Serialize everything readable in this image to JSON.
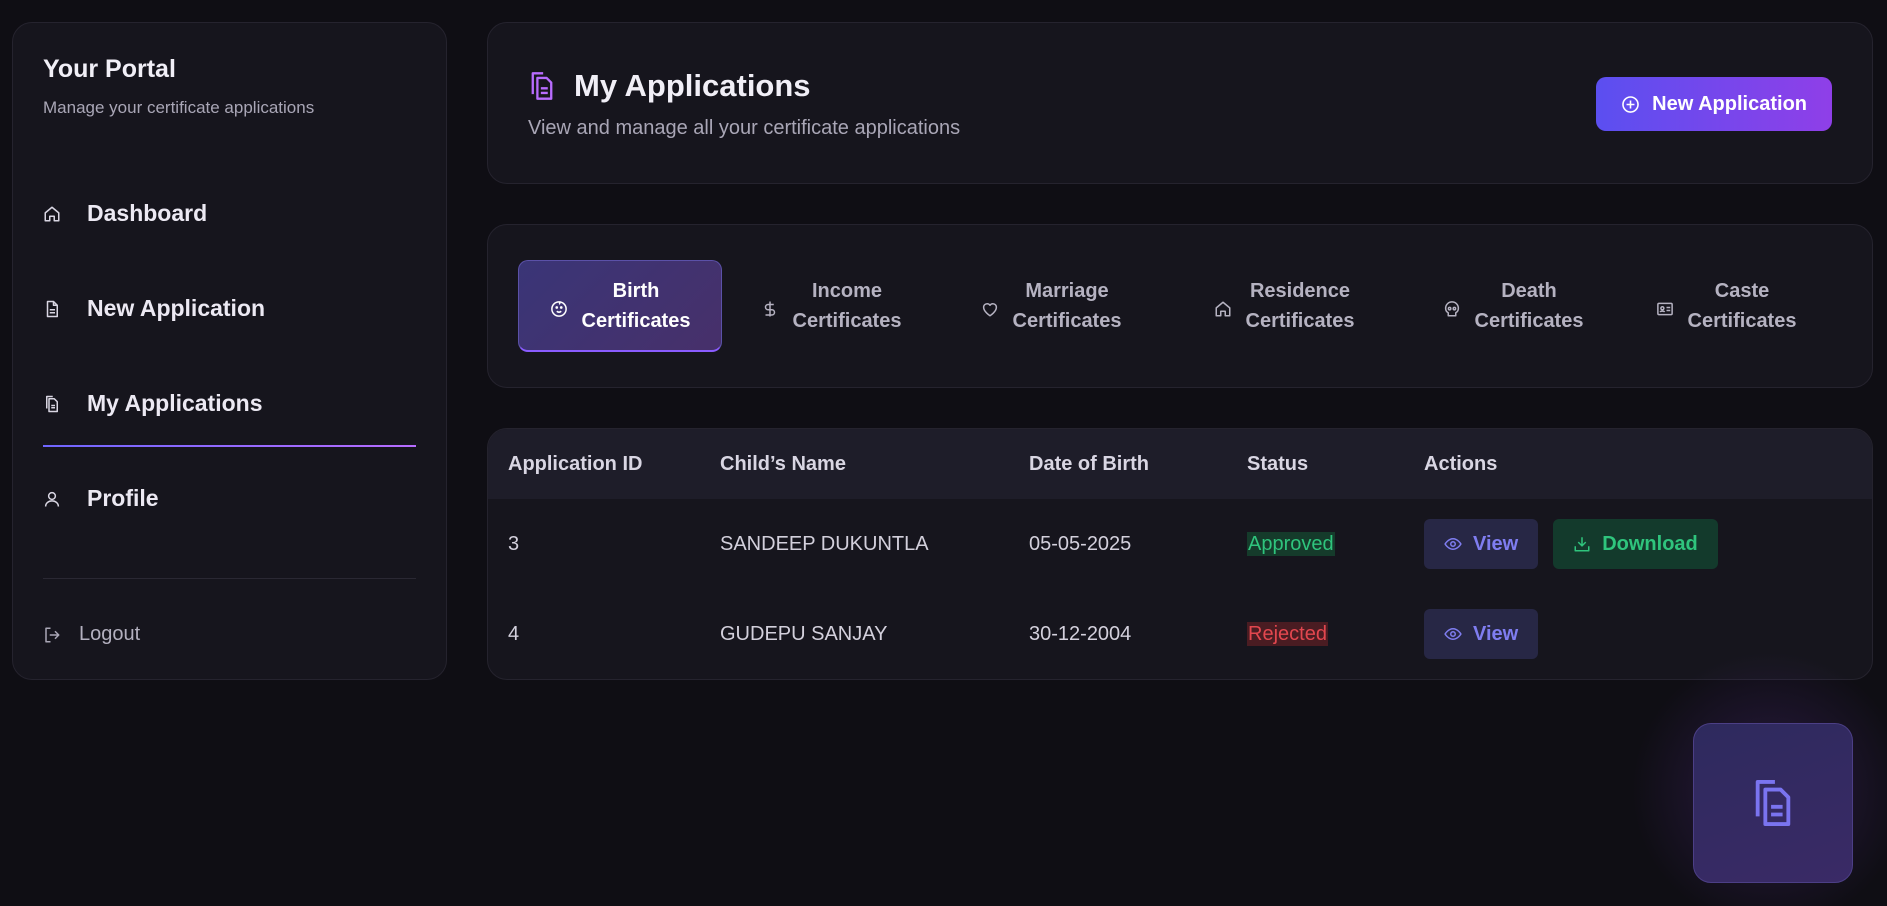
{
  "sidebar": {
    "title": "Your Portal",
    "subtitle": "Manage your certificate applications",
    "items": [
      {
        "label": "Dashboard",
        "icon": "home-icon"
      },
      {
        "label": "New Application",
        "icon": "file-icon"
      },
      {
        "label": "My Applications",
        "icon": "files-icon",
        "active": true
      },
      {
        "label": "Profile",
        "icon": "user-icon"
      }
    ],
    "logout_label": "Logout"
  },
  "header": {
    "title": "My Applications",
    "subtitle": "View and manage all your certificate applications",
    "new_button_label": "New Application"
  },
  "tabs": [
    {
      "line1": "Birth",
      "line2": "Certificates",
      "icon": "baby-icon",
      "active": true
    },
    {
      "line1": "Income",
      "line2": "Certificates",
      "icon": "dollar-icon"
    },
    {
      "line1": "Marriage",
      "line2": "Certificates",
      "icon": "heart-icon"
    },
    {
      "line1": "Residence",
      "line2": "Certificates",
      "icon": "home-icon"
    },
    {
      "line1": "Death",
      "line2": "Certificates",
      "icon": "skull-icon"
    },
    {
      "line1": "Caste",
      "line2": "Certificates",
      "icon": "id-card-icon"
    }
  ],
  "table": {
    "columns": [
      "Application ID",
      "Child’s Name",
      "Date of Birth",
      "Status",
      "Actions"
    ],
    "rows": [
      {
        "id": "3",
        "name": "SANDEEP DUKUNTLA",
        "dob": "05-05-2025",
        "status": "Approved",
        "view_label": "View",
        "download_label": "Download"
      },
      {
        "id": "4",
        "name": "GUDEPU SANJAY",
        "dob": "30-12-2004",
        "status": "Rejected",
        "view_label": "View"
      }
    ]
  },
  "colors": {
    "accent_start": "#5b4ff0",
    "accent_end": "#8f3fe8",
    "approved": "#2fc47d",
    "rejected": "#e2474f",
    "background": "#0f0e14"
  }
}
